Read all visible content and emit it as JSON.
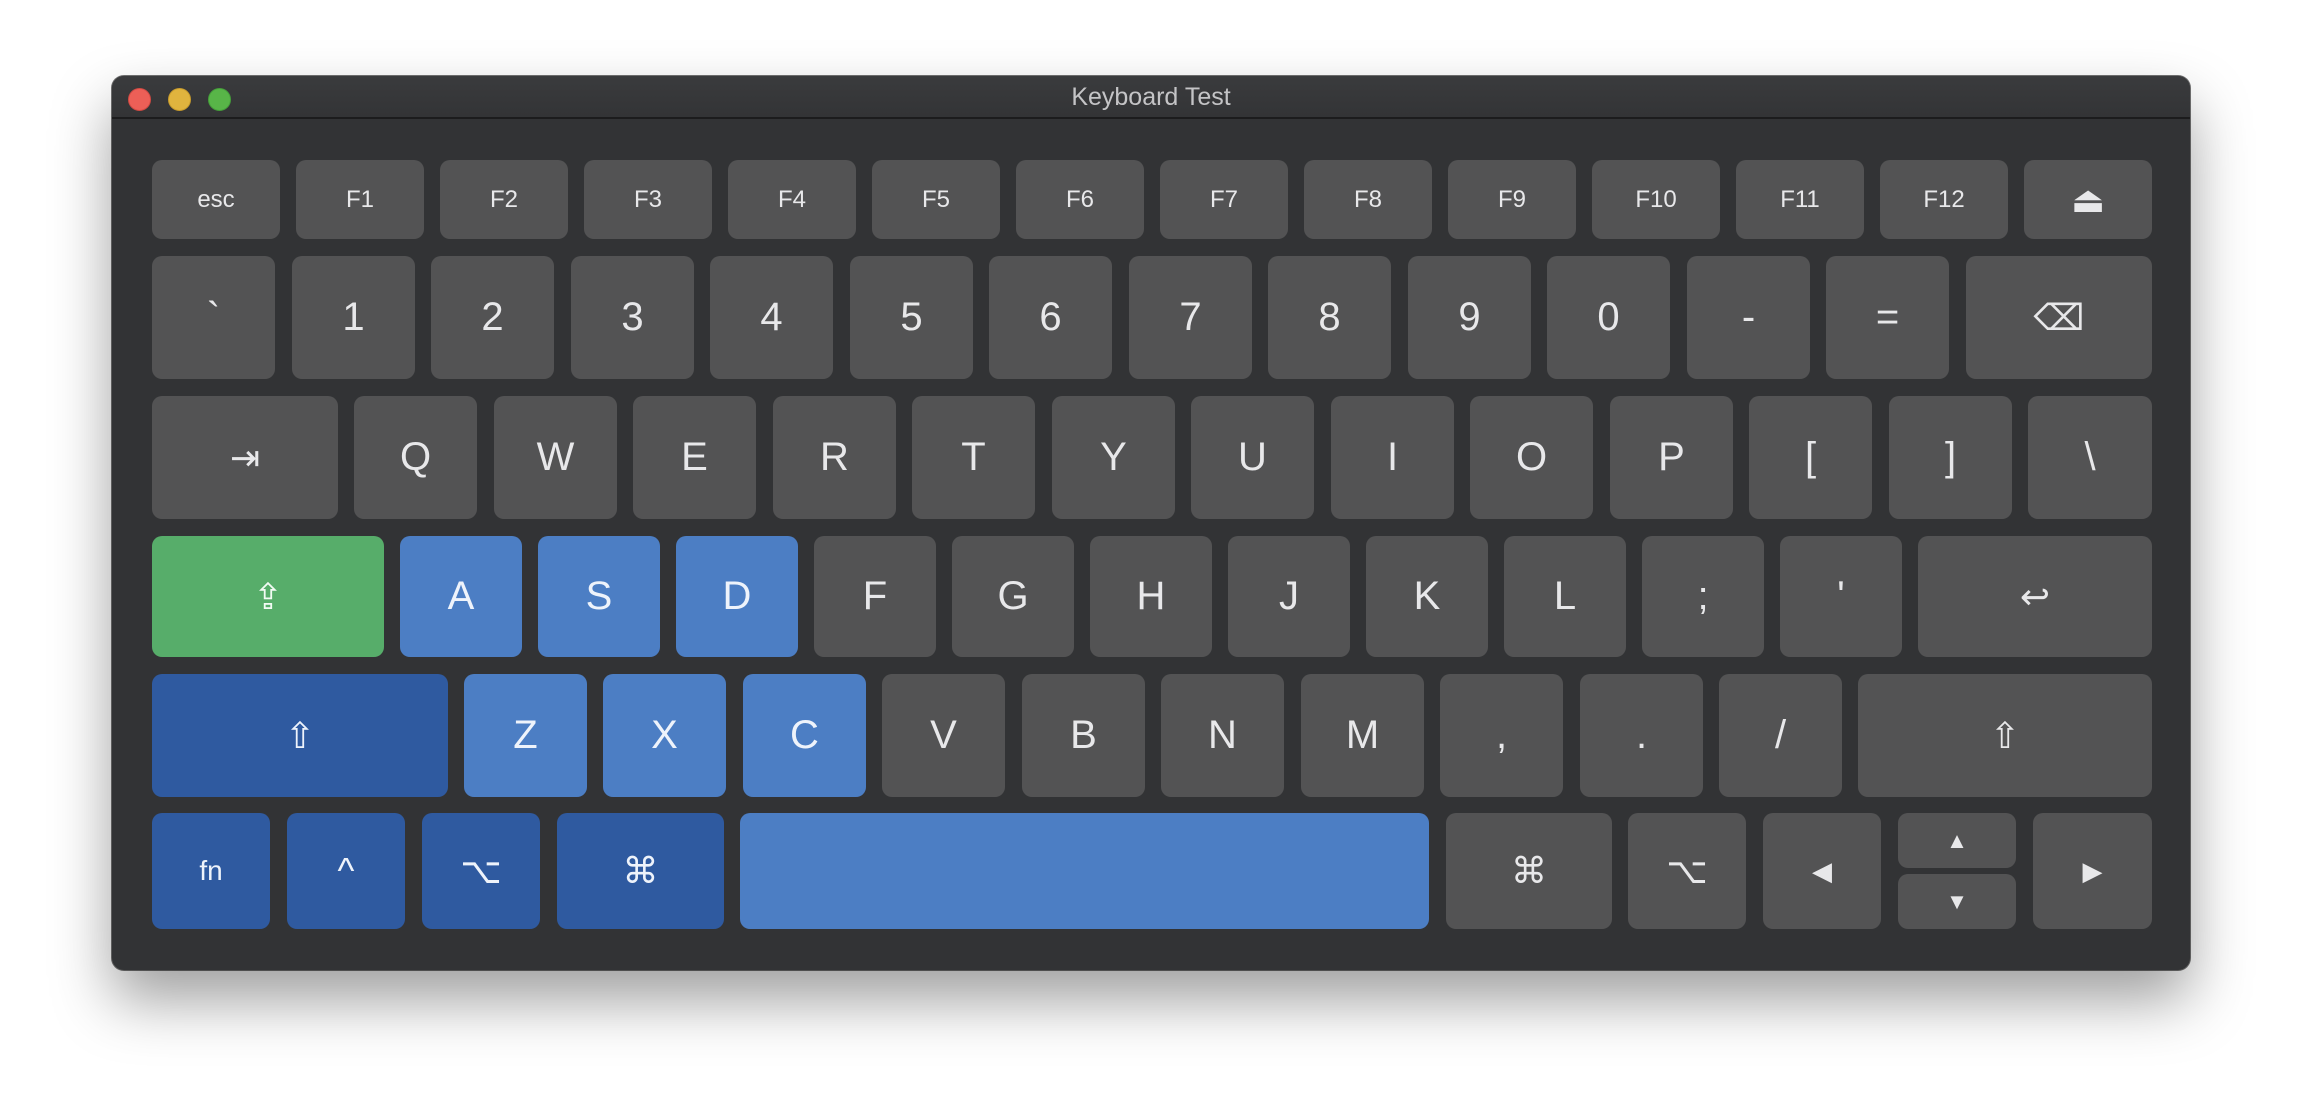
{
  "window": {
    "title": "Keyboard Test"
  },
  "colors": {
    "key": "#535354",
    "pressed_light": "#4c7ec4",
    "pressed_dark": "#2f5aa0",
    "pressed_green": "#57ad6a",
    "window_bg": "#323335"
  },
  "rows": {
    "function": [
      "esc",
      "F1",
      "F2",
      "F3",
      "F4",
      "F5",
      "F6",
      "F7",
      "F8",
      "F9",
      "F10",
      "F11",
      "F12",
      "⏏"
    ],
    "number": [
      "`",
      "1",
      "2",
      "3",
      "4",
      "5",
      "6",
      "7",
      "8",
      "9",
      "0",
      "-",
      "=",
      "⌫"
    ],
    "top": [
      "⇥",
      "Q",
      "W",
      "E",
      "R",
      "T",
      "Y",
      "U",
      "I",
      "O",
      "P",
      "[",
      "]",
      "\\"
    ],
    "home": [
      "⇪",
      "A",
      "S",
      "D",
      "F",
      "G",
      "H",
      "J",
      "K",
      "L",
      ";",
      "'",
      "↩"
    ],
    "bottom": [
      "⇧",
      "Z",
      "X",
      "C",
      "V",
      "B",
      "N",
      "M",
      ",",
      ".",
      "/",
      "⇧"
    ],
    "modifier": [
      "fn",
      "^",
      "⌥",
      "⌘",
      "",
      "⌘",
      "⌥",
      "◀",
      "▲",
      "▼",
      "▶"
    ]
  },
  "pressed_keys": [
    "⇪",
    "A",
    "S",
    "D",
    "⇧ (left)",
    "Z",
    "X",
    "C",
    "fn",
    "^",
    "⌥ (left)",
    "⌘ (left)",
    "space"
  ],
  "icons": {
    "eject": "eject-icon",
    "delete": "delete-backward-icon",
    "tab": "tab-icon",
    "caps_lock": "caps-lock-icon",
    "return": "return-icon",
    "shift": "shift-icon",
    "command": "command-icon",
    "option": "option-icon",
    "control": "control-icon"
  }
}
